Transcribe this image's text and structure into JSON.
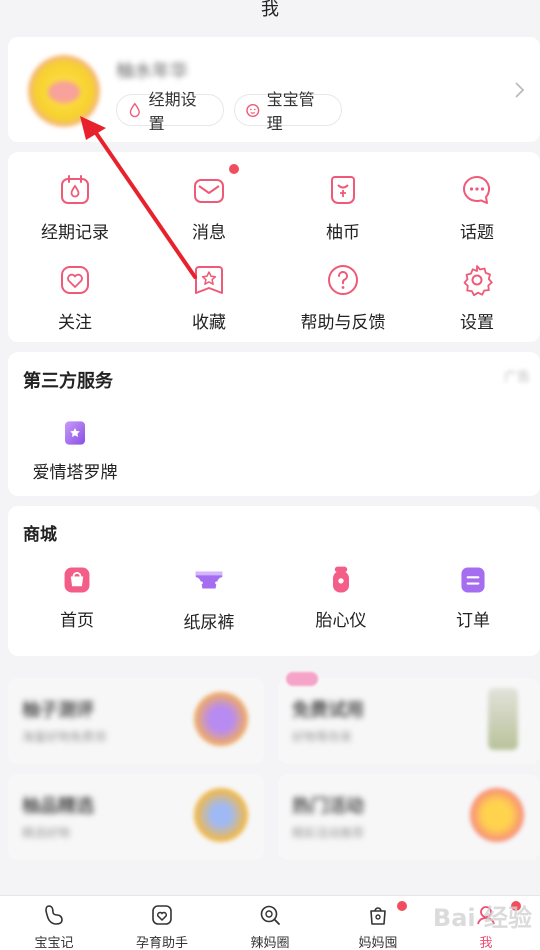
{
  "header": {
    "title": "我"
  },
  "profile": {
    "nickname": "柚水年华",
    "pills": [
      {
        "label": "经期设置"
      },
      {
        "label": "宝宝管理"
      }
    ]
  },
  "menu": {
    "items": [
      {
        "label": "经期记录",
        "icon": "calendar-drop-icon"
      },
      {
        "label": "消息",
        "icon": "envelope-icon"
      },
      {
        "label": "柚币",
        "icon": "coin-pouch-icon"
      },
      {
        "label": "话题",
        "icon": "chat-bubble-icon"
      },
      {
        "label": "关注",
        "icon": "heart-icon"
      },
      {
        "label": "收藏",
        "icon": "star-bookmark-icon"
      },
      {
        "label": "帮助与反馈",
        "icon": "help-icon"
      },
      {
        "label": "设置",
        "icon": "gear-icon"
      }
    ]
  },
  "third_party": {
    "title": "第三方服务",
    "ad_tag": "广告",
    "items": [
      {
        "label": "爱情塔罗牌",
        "icon": "tarot-icon"
      }
    ]
  },
  "mall": {
    "title": "商城",
    "items": [
      {
        "label": "首页",
        "icon": "shop-home-icon"
      },
      {
        "label": "纸尿裤",
        "icon": "diaper-icon"
      },
      {
        "label": "胎心仪",
        "icon": "doppler-icon"
      },
      {
        "label": "订单",
        "icon": "order-icon"
      }
    ]
  },
  "promos": [
    {
      "title": "柚子测评",
      "subtitle": "海量好物免费领"
    },
    {
      "title": "免费试用",
      "subtitle": "好物等你来"
    },
    {
      "title": "柚品精选",
      "subtitle": "精选好物"
    },
    {
      "title": "热门活动",
      "subtitle": "精彩活动推荐"
    }
  ],
  "tabbar": {
    "tabs": [
      {
        "label": "宝宝记"
      },
      {
        "label": "孕育助手"
      },
      {
        "label": "辣妈圈"
      },
      {
        "label": "妈妈囤"
      },
      {
        "label": "我"
      }
    ]
  },
  "watermark": "Bai 经验",
  "colors": {
    "accent": "#f04e72",
    "icon_stroke": "#ef5a77",
    "badge": "#f04e5e",
    "arrow": "#e8222c"
  }
}
